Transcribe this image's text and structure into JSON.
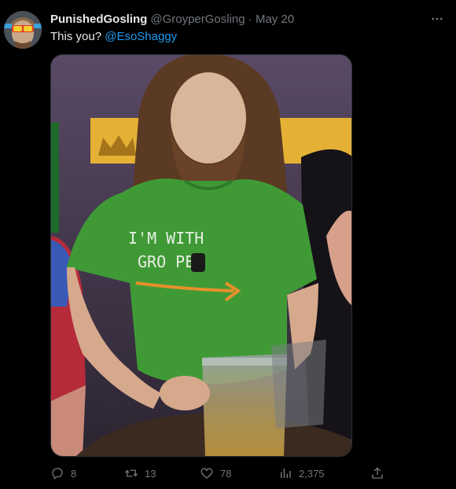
{
  "author": {
    "display_name": "PunishedGosling",
    "handle": "@GroyperGosling",
    "separator": "·",
    "date": "May 20"
  },
  "tweet": {
    "text": "This you?",
    "mention": "@EsoShaggy"
  },
  "media": {
    "shirt_line1": "I'M WITH",
    "shirt_line2": "GRO PER"
  },
  "actions": {
    "replies": "8",
    "retweets": "13",
    "likes": "78",
    "views": "2,375"
  },
  "colors": {
    "background": "#000000",
    "text": "#e7e9ea",
    "muted": "#71767b",
    "link": "#1d9bf0"
  }
}
